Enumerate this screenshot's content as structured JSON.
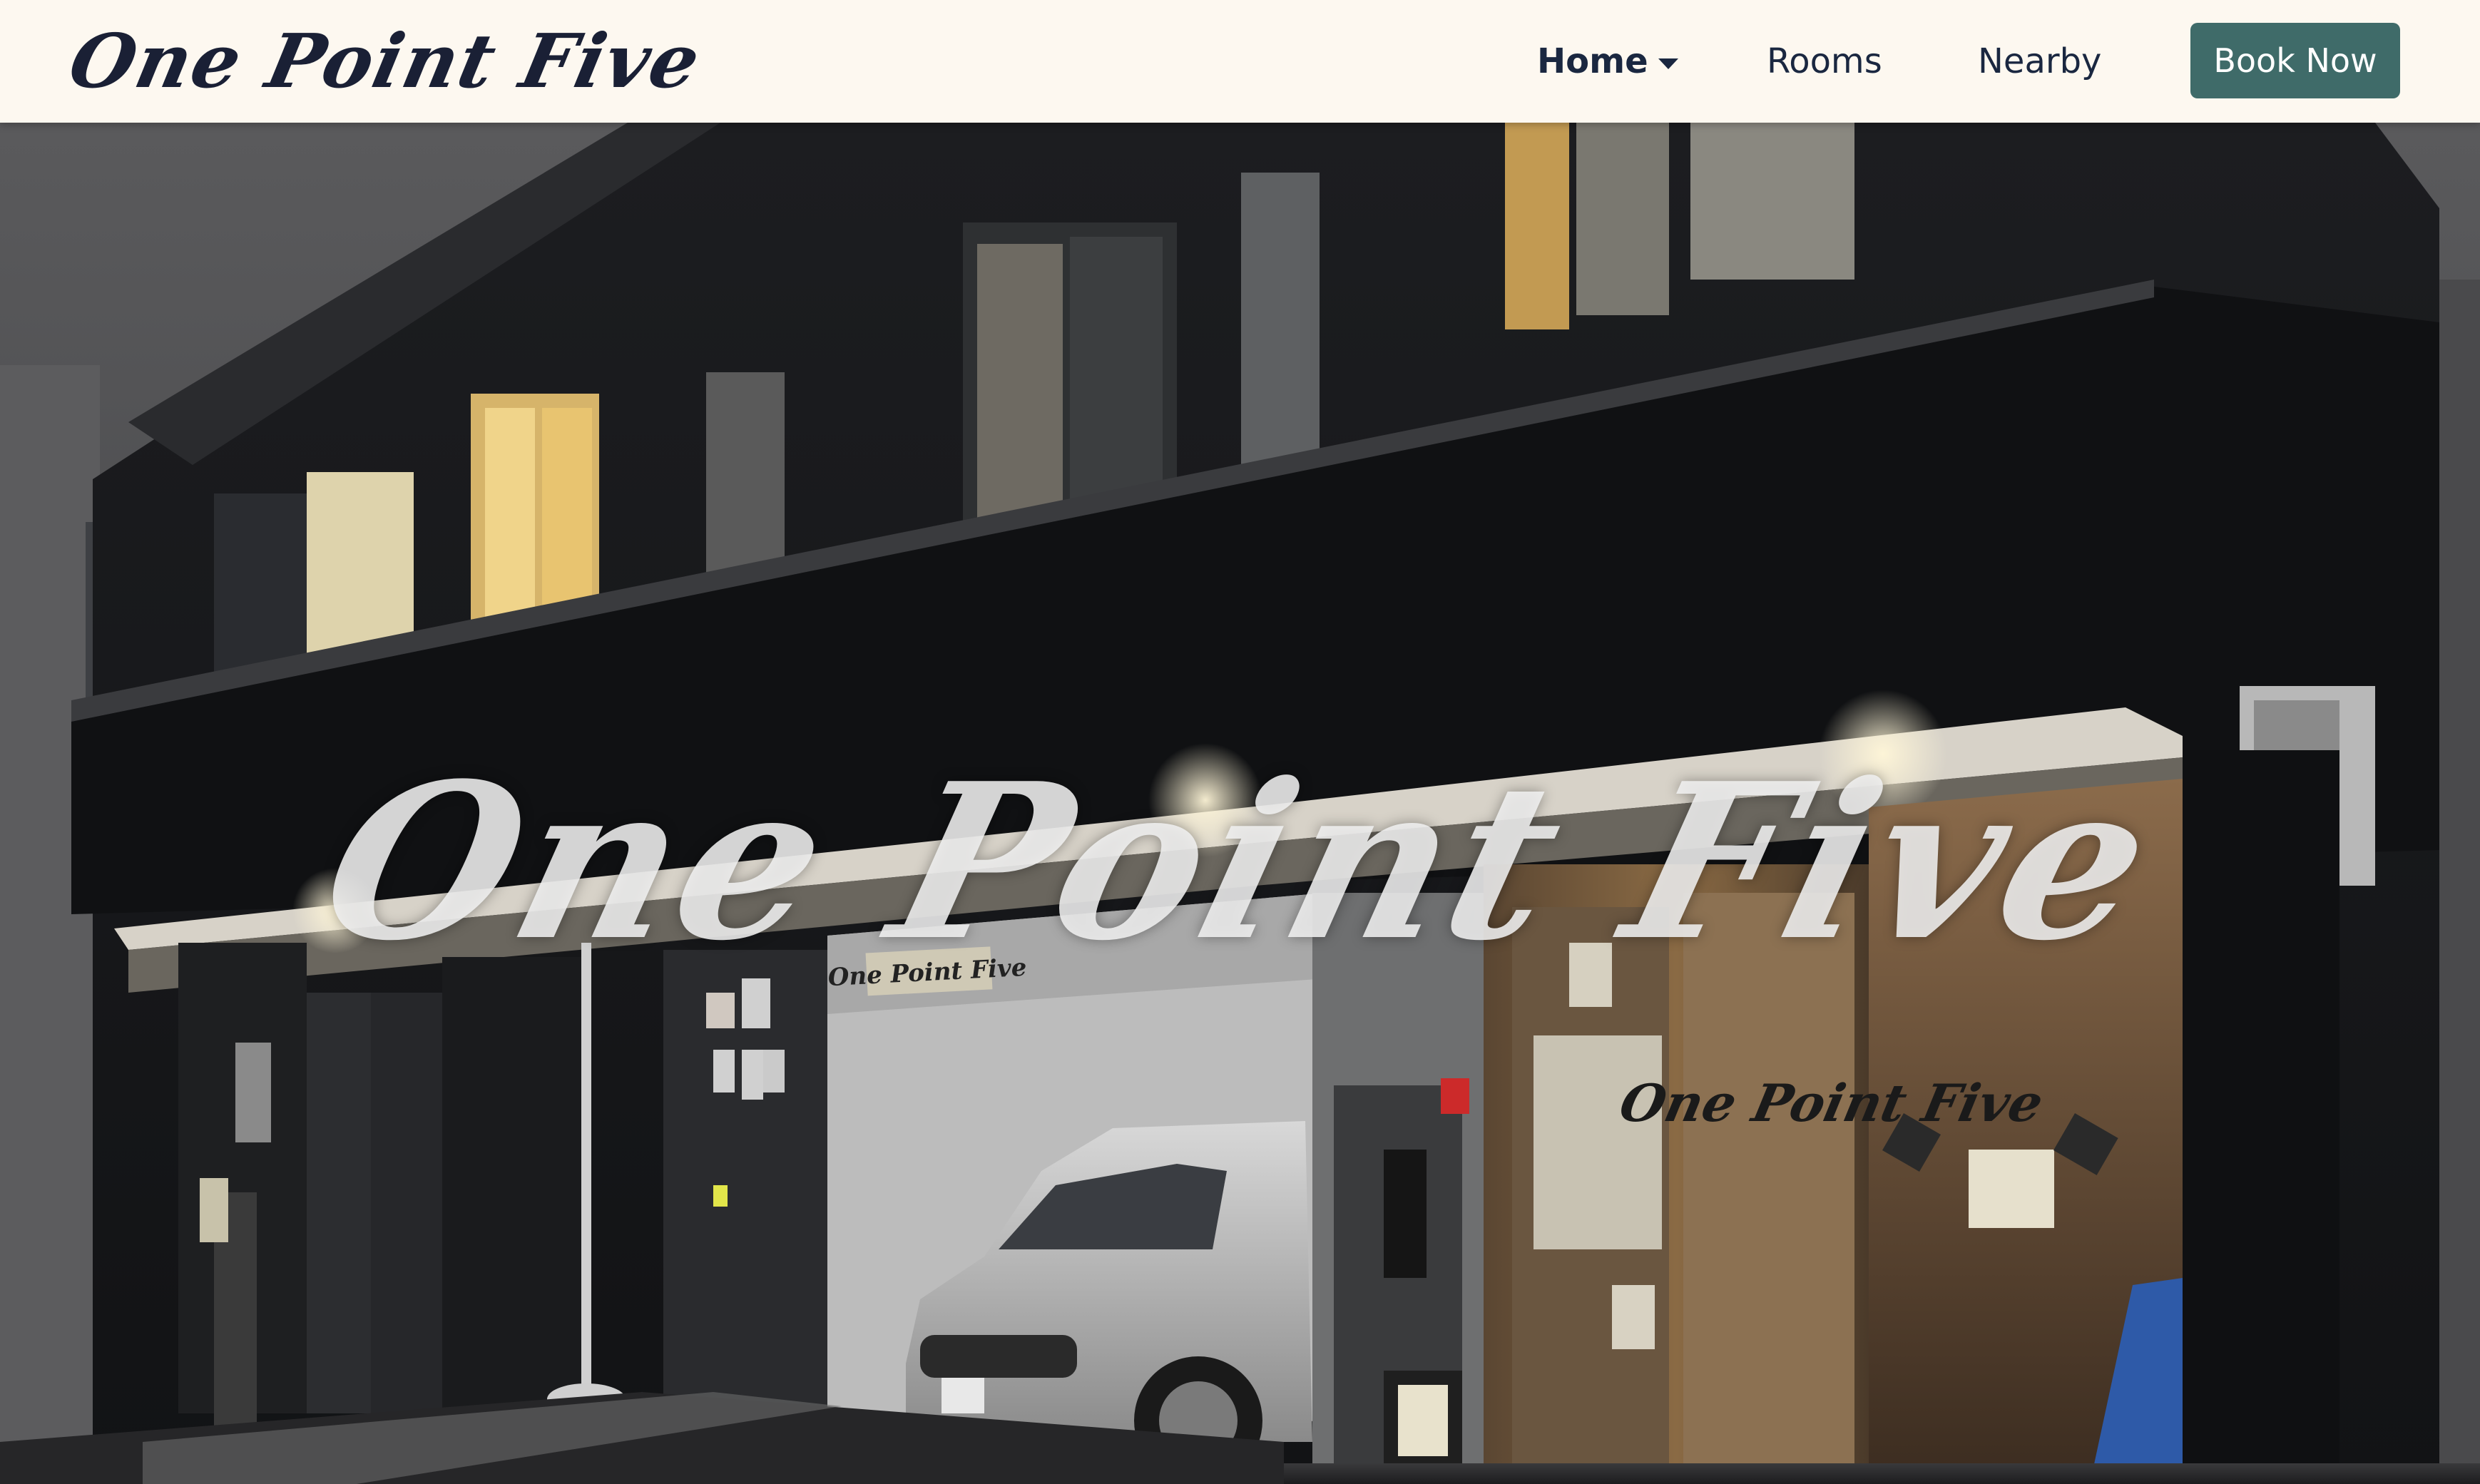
{
  "header": {
    "brand": "One Point Five",
    "nav": {
      "home": "Home",
      "rooms": "Rooms",
      "nearby": "Nearby"
    },
    "book_label": "Book Now"
  },
  "hero": {
    "title": "One Point Five",
    "building_sign": "One Point Five",
    "wall_sign": "One Point Five"
  },
  "colors": {
    "header_bg": "#fdf8f0",
    "nav_text": "#1a2740",
    "brand_text": "#1a2035",
    "book_button_bg": "#3f6b69",
    "book_button_text": "#ffffff"
  },
  "icons": {
    "home_dropdown": "chevron-down-icon"
  }
}
